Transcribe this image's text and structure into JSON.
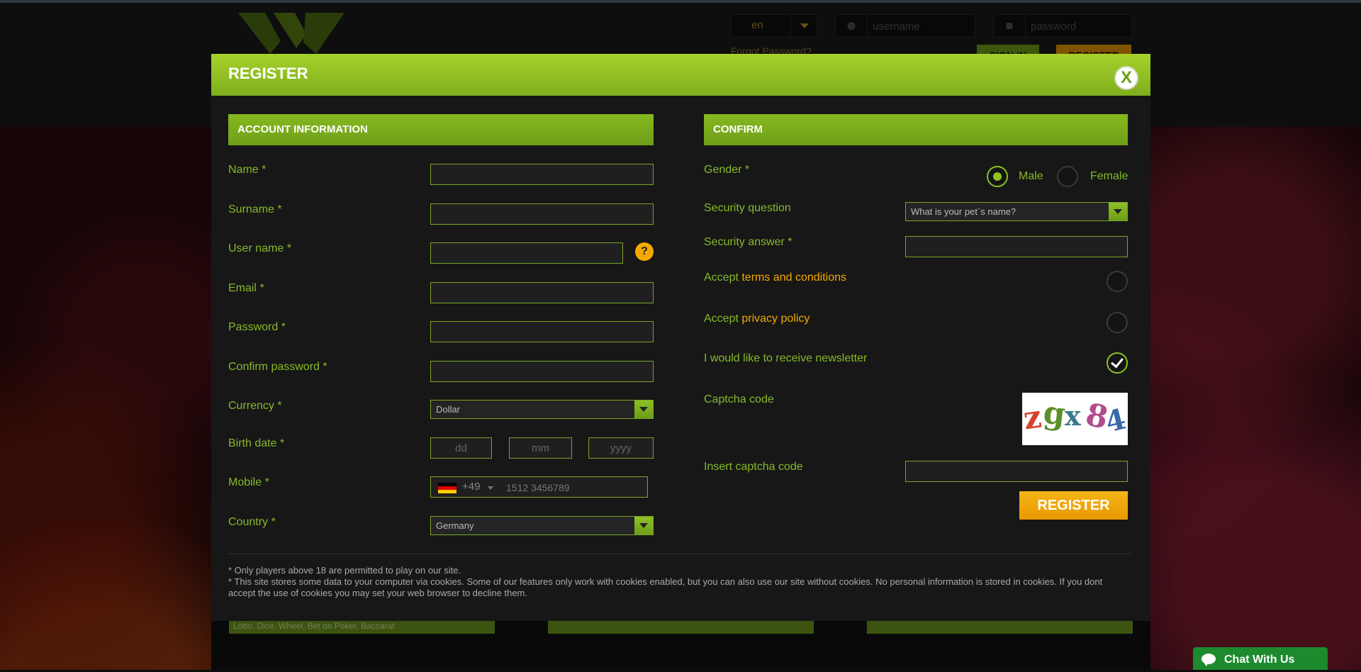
{
  "header": {
    "language": "en",
    "username_placeholder": "username",
    "password_placeholder": "password",
    "forgot_password": "Forgot Password?",
    "sign_in": "SIGN IN",
    "register": "REGISTER"
  },
  "categories": {
    "first_caption": "Lotto, Dice, Wheel, Bet on Poker, Baccarat"
  },
  "chat": {
    "label": "Chat With Us"
  },
  "modal": {
    "title": "REGISTER",
    "close_label": "X",
    "account": {
      "heading": "ACCOUNT INFORMATION",
      "name_label": "Name *",
      "surname_label": "Surname *",
      "username_label": "User name *",
      "username_help": "?",
      "email_label": "Email *",
      "password_label": "Password *",
      "confirm_password_label": "Confirm password *",
      "currency_label": "Currency *",
      "currency_value": "Dollar",
      "birth_label": "Birth date *",
      "birth_dd": "dd",
      "birth_mm": "mm",
      "birth_yyyy": "yyyy",
      "mobile_label": "Mobile *",
      "mobile_code": "+49",
      "mobile_placeholder": "1512 3456789",
      "country_label": "Country *",
      "country_value": "Germany"
    },
    "confirm": {
      "heading": "CONFIRM",
      "gender_label": "Gender *",
      "gender_male": "Male",
      "gender_female": "Female",
      "security_question_label": "Security question",
      "security_question_value": "What is your pet`s name?",
      "security_answer_label": "Security answer *",
      "accept_prefix": "Accept ",
      "terms_link": "terms and conditions",
      "privacy_link": "privacy policy",
      "newsletter_label": "I would like to receive newsletter",
      "captcha_label": "Captcha code",
      "captcha_chars": [
        "z",
        "g",
        "x",
        "8",
        "4"
      ],
      "insert_captcha_label": "Insert captcha code",
      "register_button": "REGISTER"
    },
    "notes": [
      "* Only players above 18 are permitted to play on our site.",
      "* This site stores some data to your computer via cookies. Some of our features only work with cookies enabled, but you can also use our site without cookies. No personal information is stored in cookies. If you dont accept the use of cookies you may set your web browser to decline them."
    ]
  },
  "colors": {
    "accent_green": "#86b92a",
    "accent_orange": "#f2a900",
    "chat_green": "#1c8a2d"
  }
}
